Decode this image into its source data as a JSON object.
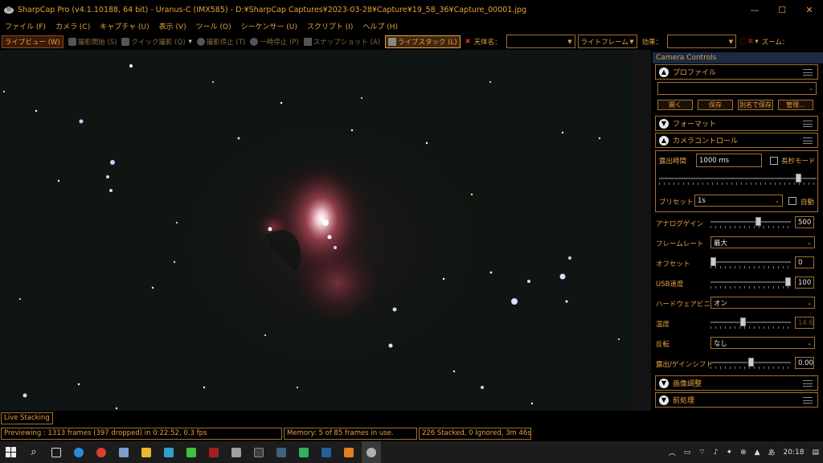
{
  "titlebar": {
    "title": "SharpCap Pro (v4.1.10188, 64 bit) - Uranus-C (IMX585) - D:¥SharpCap Captures¥2023-03-28¥Capture¥19_58_36¥Capture_00001.jpg",
    "minimize": "—",
    "maximize": "☐",
    "close": "✕"
  },
  "menu": [
    "ファイル (F)",
    "カメラ (C)",
    "キャプチャ (U)",
    "表示 (V)",
    "ツール (O)",
    "シーケンサー (U)",
    "スクリプト (I)",
    "ヘルプ (H)"
  ],
  "toolbar": {
    "live_view": "ライブビュー (W)",
    "start_capture": "撮影開始 (S)",
    "quick_capture": "クイック撮影 (Q)",
    "stop_capture": "撮影停止 (T)",
    "pause": "一時停止 (P)",
    "snapshot": "スナップショット (A)",
    "live_stack": "ライブスタック (L)",
    "target_label": "天体名：",
    "target_value": "",
    "frame_type": "ライトフレーム",
    "effect_label": "効果：",
    "effect_value": "",
    "zoom_label": "ズーム："
  },
  "panel": {
    "title": "Camera Controls",
    "profile": {
      "title": "プロファイル",
      "select_value": "",
      "buttons": [
        "開く",
        "保存",
        "別名で保存",
        "管理..."
      ]
    },
    "format": {
      "title": "フォーマット"
    },
    "camera_control": {
      "title": "カメラコントロール",
      "exposure_label": "露出時間",
      "exposure_value": "1000 ms",
      "long_exposure_label": "長秒モード",
      "preset_label": "プリセット",
      "preset_value": "1s",
      "auto_label": "自動",
      "analog_gain_label": "アナログゲイン",
      "analog_gain_value": "500",
      "analog_gain_level": 0.6,
      "framerate_label": "フレームレート",
      "framerate_value": "最大",
      "offset_label": "オフセット",
      "offset_value": "0",
      "offset_level": 0.0,
      "usb_label": "USB速度",
      "usb_value": "100",
      "usb_level": 1.0,
      "binning_label": "ハードウェアビニング",
      "binning_value": "オン",
      "temp_label": "温度",
      "temp_value": "14.6",
      "temp_level": 0.4,
      "flip_label": "反転",
      "flip_value": "なし",
      "gain_shift_label": "露出/ゲインシフト",
      "gain_shift_value": "0.00",
      "gain_shift_level": 0.5
    },
    "image_adjust": {
      "title": "画像調整"
    },
    "preprocess": {
      "title": "前処理"
    }
  },
  "status": {
    "live_tab": "Live Stacking",
    "previewing": "Previewing : 1313 frames (397 dropped) in 0:22:52, 0.3 fps",
    "memory": "Memory: 5 of 85 frames in use.",
    "stacked": "226 Stacked, 0 Ignored, 3m 46s"
  },
  "taskbar": {
    "clock": "20:18"
  },
  "colors": {
    "accent": "#e8a040",
    "background": "#000000",
    "sky": "#0f1512"
  }
}
